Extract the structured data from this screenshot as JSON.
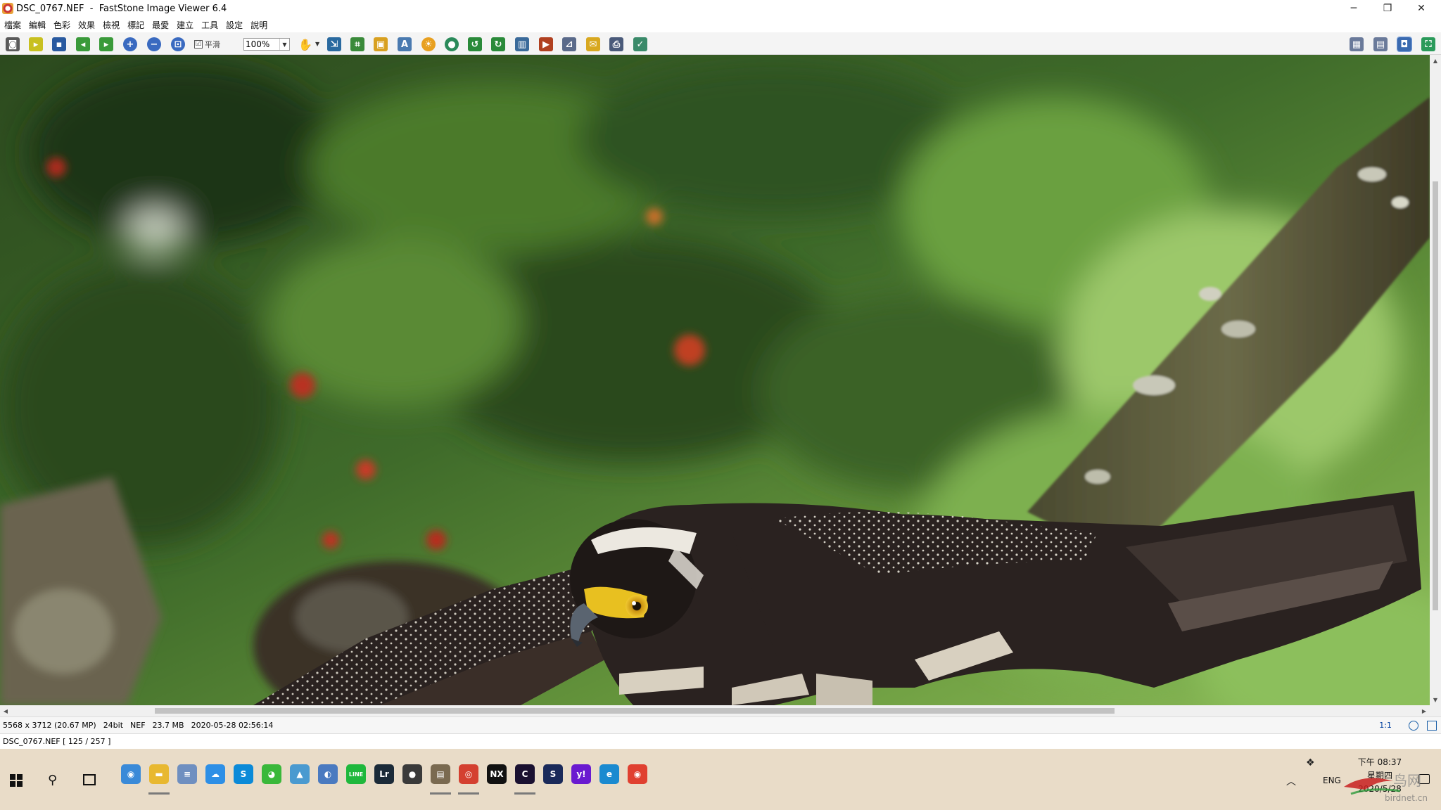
{
  "window": {
    "title": "DSC_0767.NEF  -  FastStone Image Viewer 6.4",
    "minimize": "─",
    "restore": "❐",
    "close": "✕"
  },
  "menu": [
    "檔案",
    "編輯",
    "色彩",
    "效果",
    "檢視",
    "標記",
    "最愛",
    "建立",
    "工具",
    "設定",
    "說明"
  ],
  "toolbar": {
    "smooth_label": "平滑",
    "smooth_checked": "☑",
    "zoom_value": "100%",
    "hand_icon": "✋"
  },
  "photo": {
    "subject": "crested serpent eagle in flight",
    "colors": {
      "foliage": "#3f6b2a",
      "bright_foliage": "#8ebd5a",
      "bark": "#6b5a3a",
      "bird": "#2a2220",
      "eye": "#e8b820"
    }
  },
  "status": {
    "dimensions": "5568 x 3712 (20.67 MP)",
    "bitdepth": "24bit",
    "format": "NEF",
    "size": "23.7 MB",
    "datetime": "2020-05-28 02:56:14",
    "ratio": "1:1",
    "file_position": "DSC_0767.NEF [ 125 / 257 ]"
  },
  "taskbar": {
    "apps": [
      {
        "name": "windows-media-icon",
        "color": "#3a8ad8",
        "glyph": "◉"
      },
      {
        "name": "file-explorer-icon",
        "color": "#e8b830",
        "glyph": "▬"
      },
      {
        "name": "notepad-icon",
        "color": "#6f8fc0",
        "glyph": "≡"
      },
      {
        "name": "onedrive-icon",
        "color": "#2d8fe6",
        "glyph": "☁"
      },
      {
        "name": "skype-icon",
        "color": "#0b8ad8",
        "glyph": "S"
      },
      {
        "name": "wechat-icon",
        "color": "#3ab83a",
        "glyph": "◕"
      },
      {
        "name": "photos-icon",
        "color": "#4a9ad0",
        "glyph": "▲"
      },
      {
        "name": "globe-icon",
        "color": "#4a7ac0",
        "glyph": "◐"
      },
      {
        "name": "line-icon",
        "color": "#1fb83c",
        "glyph": "LINE"
      },
      {
        "name": "lightroom-icon",
        "color": "#1b2a38",
        "glyph": "Lr"
      },
      {
        "name": "magnifier-icon",
        "color": "#3a3a3a",
        "glyph": "●"
      },
      {
        "name": "clapboard-icon",
        "color": "#7a6a50",
        "glyph": "▤"
      },
      {
        "name": "faststone-icon",
        "color": "#d44030",
        "glyph": "◎"
      },
      {
        "name": "nx-icon",
        "color": "#111111",
        "glyph": "NX"
      },
      {
        "name": "capture-icon",
        "color": "#1a1030",
        "glyph": "C"
      },
      {
        "name": "shield-app-icon",
        "color": "#1a2a5a",
        "glyph": "S"
      },
      {
        "name": "yahoo-icon",
        "color": "#6a1ad0",
        "glyph": "y!"
      },
      {
        "name": "edge-icon",
        "color": "#1a8ad0",
        "glyph": "e"
      },
      {
        "name": "chrome-icon",
        "color": "#e04030",
        "glyph": "◉"
      }
    ],
    "tray_lang": "ENG",
    "clock_time": "下午 08:37",
    "clock_day": "星期四",
    "clock_date": "2020/5/28",
    "watermark": "鸟网",
    "watermark_url": "birdnet.cn"
  }
}
